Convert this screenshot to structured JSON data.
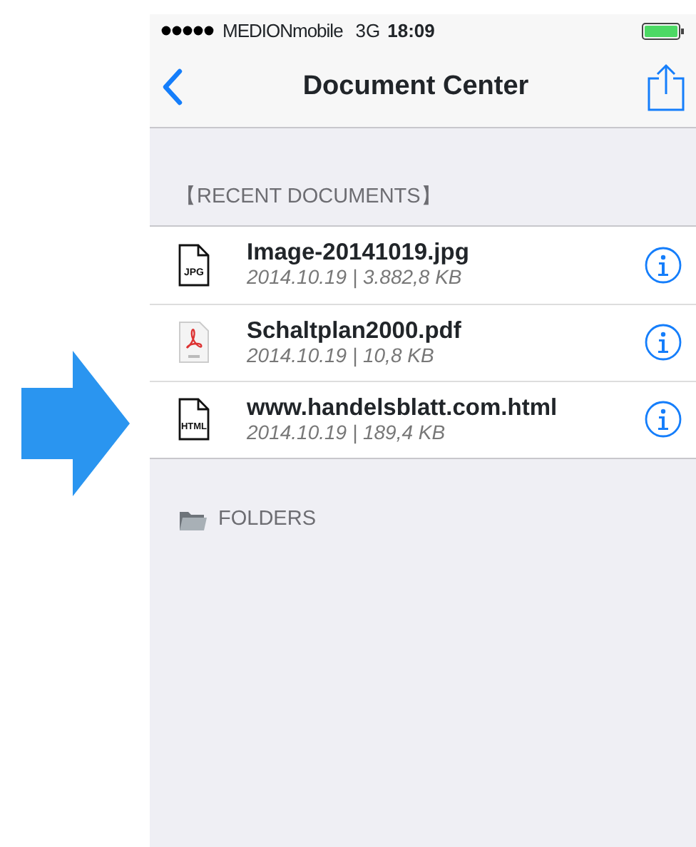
{
  "status_bar": {
    "carrier": "MEDIONmobile",
    "network": "3G",
    "time": "18:09"
  },
  "nav_bar": {
    "title": "Document Center"
  },
  "recent_section": {
    "header": "【RECENT DOCUMENTS】",
    "files": [
      {
        "kind": "doc",
        "icon_label": "JPG",
        "name": "Image-20141019.jpg",
        "details": "2014.10.19 | 3.882,8 KB"
      },
      {
        "kind": "pdf",
        "name": "Schaltplan2000.pdf",
        "details": "2014.10.19 | 10,8 KB"
      },
      {
        "kind": "doc",
        "icon_label": "HTML",
        "name": "www.handelsblatt.com.html",
        "details": "2014.10.19 | 189,4 KB"
      }
    ]
  },
  "folders_section": {
    "header": "FOLDERS"
  }
}
